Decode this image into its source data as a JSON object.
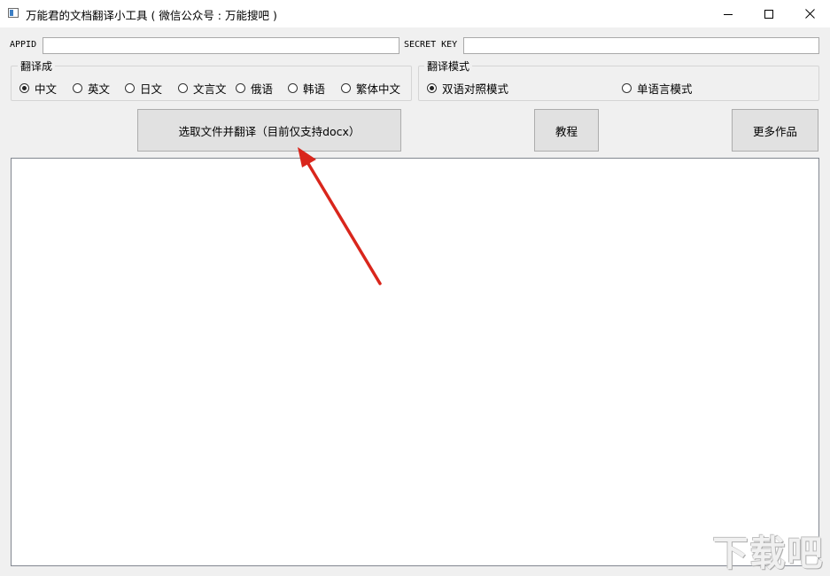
{
  "window": {
    "title": "万能君的文档翻译小工具 ( 微信公众号 : 万能搜吧 )"
  },
  "credentials": {
    "appid_label": "APPID",
    "appid_value": "",
    "secret_label": "SECRET KEY",
    "secret_value": ""
  },
  "target_language": {
    "title": "翻译成",
    "options": [
      {
        "label": "中文",
        "selected": true
      },
      {
        "label": "英文",
        "selected": false
      },
      {
        "label": "日文",
        "selected": false
      },
      {
        "label": "文言文",
        "selected": false
      },
      {
        "label": "俄语",
        "selected": false
      },
      {
        "label": "韩语",
        "selected": false
      },
      {
        "label": "繁体中文",
        "selected": false
      }
    ]
  },
  "translate_mode": {
    "title": "翻译模式",
    "options": [
      {
        "label": "双语对照模式",
        "selected": true
      },
      {
        "label": "单语言模式",
        "selected": false
      }
    ]
  },
  "buttons": {
    "select_file": "选取文件并翻译（目前仅支持docx）",
    "tutorial": "教程",
    "more_works": "更多作品"
  },
  "output": {
    "text": ""
  },
  "annotation": {
    "arrow_color": "#d9261c"
  },
  "watermark": {
    "text": "下载吧"
  },
  "icons": {
    "app": "app-window-icon",
    "minimize": "minimize-icon",
    "maximize": "maximize-icon",
    "close": "close-icon"
  }
}
